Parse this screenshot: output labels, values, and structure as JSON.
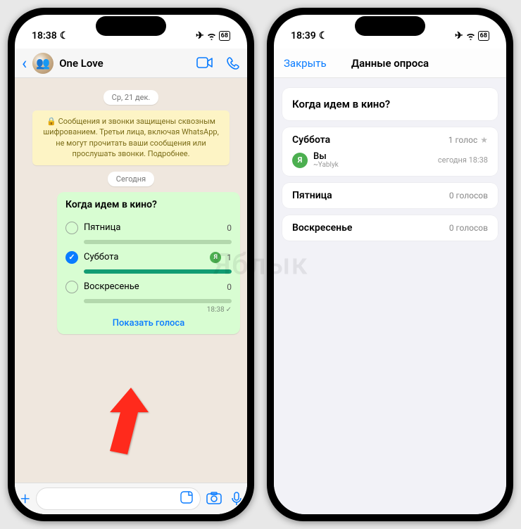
{
  "watermark": "Яблык",
  "left": {
    "status": {
      "time": "18:38",
      "battery": "68"
    },
    "header": {
      "title": "One Love"
    },
    "date1": "Ср, 21 дек.",
    "encryption": "🔒 Сообщения и звонки защищены сквозным шифрованием. Третьи лица, включая WhatsApp, не могут прочитать ваши сообщения или прослушать звонки. Подробнее.",
    "date2": "Сегодня",
    "poll": {
      "question": "Когда идем в кино?",
      "options": [
        {
          "label": "Пятница",
          "count": "0",
          "checked": false,
          "full": false,
          "avatar": false
        },
        {
          "label": "Суббота",
          "count": "1",
          "checked": true,
          "full": true,
          "avatar": true
        },
        {
          "label": "Воскресенье",
          "count": "0",
          "checked": false,
          "full": false,
          "avatar": false
        }
      ],
      "time": "18:38",
      "show_votes": "Показать голоса"
    }
  },
  "right": {
    "status": {
      "time": "18:39",
      "battery": "68"
    },
    "header": {
      "close": "Закрыть",
      "title": "Данные опроса"
    },
    "question": "Когда идем в кино?",
    "options": [
      {
        "name": "Суббота",
        "votes": "1 голос",
        "star": true,
        "voters": [
          {
            "avatar": "Я",
            "name": "Вы",
            "sub": "~Yablyk",
            "time": "сегодня 18:38"
          }
        ]
      },
      {
        "name": "Пятница",
        "votes": "0 голосов",
        "star": false,
        "voters": []
      },
      {
        "name": "Воскресенье",
        "votes": "0 голосов",
        "star": false,
        "voters": []
      }
    ]
  }
}
